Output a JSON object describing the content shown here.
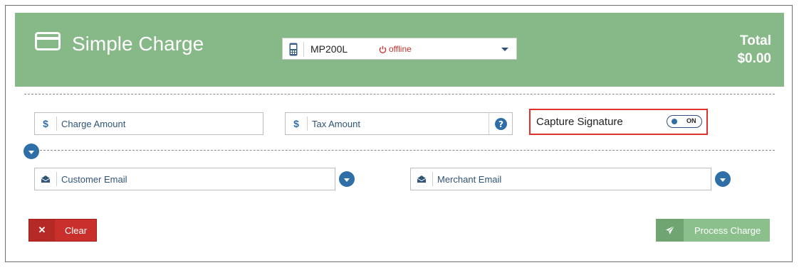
{
  "header": {
    "title": "Simple Charge",
    "device": {
      "name": "MP200L",
      "status": "offline"
    },
    "total": {
      "label": "Total",
      "amount": "$0.00"
    }
  },
  "charge_amount": {
    "prefix": "$",
    "placeholder": "Charge Amount"
  },
  "tax_amount": {
    "prefix": "$",
    "placeholder": "Tax Amount",
    "help_icon": "question-circle-icon"
  },
  "capture_signature": {
    "label": "Capture Signature",
    "toggle_label": "ON",
    "enabled": true
  },
  "customer_email": {
    "placeholder": "Customer Email",
    "icon": "envelope-open-icon"
  },
  "merchant_email": {
    "placeholder": "Merchant Email",
    "icon": "envelope-open-icon"
  },
  "buttons": {
    "clear": {
      "label": "Clear",
      "icon": "x-icon"
    },
    "process": {
      "label": "Process Charge",
      "icon": "paper-plane-icon"
    }
  },
  "colors": {
    "header_bg": "#87b888",
    "accent_blue": "#2f6fa8",
    "danger": "#c9302c",
    "success": "#8bc08c"
  }
}
